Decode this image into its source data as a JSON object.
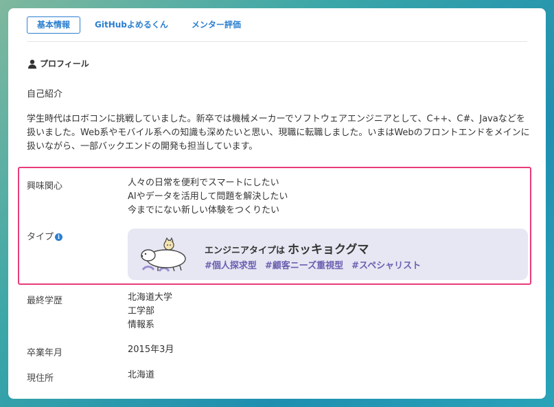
{
  "tabs": [
    {
      "label": "基本情報",
      "active": true
    },
    {
      "label": "GitHubよめるくん",
      "active": false
    },
    {
      "label": "メンター評価",
      "active": false
    }
  ],
  "profile": {
    "section_title": "プロフィール",
    "intro_label": "自己紹介",
    "intro_text": "学生時代はロボコンに挑戦していました。新卒では機械メーカーでソフトウェアエンジニアとして、C++、C#、Javaなどを扱いました。Web系やモバイル系への知識も深めたいと思い、現職に転職しました。いまはWebのフロントエンドをメインに扱いながら、一部バックエンドの開発も担当しています。"
  },
  "interests": {
    "label": "興味関心",
    "items": [
      "人々の日常を便利でスマートにしたい",
      "AIやデータを活用して問題を解決したい",
      "今までにない新しい体験をつくりたい"
    ]
  },
  "type": {
    "label": "タイプ",
    "info_glyph": "i",
    "prefix": "エンジニアタイプは",
    "name": "ホッキョクグマ",
    "tags": [
      "#個人探求型",
      "#顧客ニーズ重視型",
      "#スペシャリスト"
    ]
  },
  "education": {
    "label": "最終学歴",
    "values": [
      "北海道大学",
      "工学部",
      "情報系"
    ]
  },
  "graduation": {
    "label": "卒業年月",
    "value": "2015年3月"
  },
  "residence": {
    "label": "現住所",
    "value": "北海道"
  },
  "colors": {
    "accent": "#2b7fd0",
    "highlight": "#e83a7b",
    "tag": "#6a5fb0",
    "type_bg": "#e7e7f3"
  }
}
